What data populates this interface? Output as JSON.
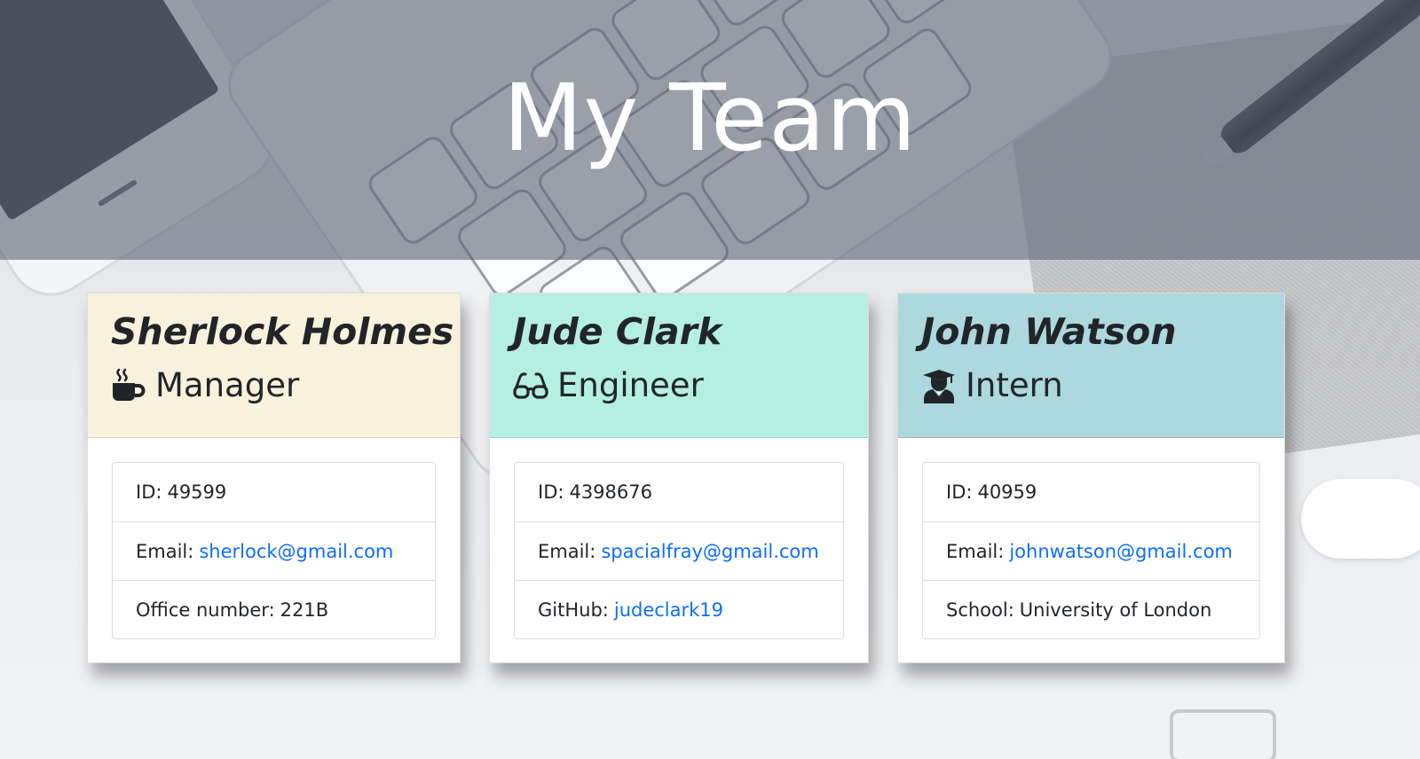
{
  "page": {
    "title": "My Team"
  },
  "colors": {
    "header_overlay": "#606576",
    "manager_header": "#f8f2dd",
    "engineer_header": "#b5efe3",
    "intern_header": "#acd8de",
    "link": "#0d6efd"
  },
  "team": [
    {
      "name": "Sherlock Holmes",
      "role": "Manager",
      "role_icon": "coffee-mug-icon",
      "items": [
        {
          "label": "ID:",
          "value": "49599"
        },
        {
          "label": "Email:",
          "value": "sherlock@gmail.com",
          "link": true
        },
        {
          "label": "Office number:",
          "value": "221B"
        }
      ]
    },
    {
      "name": "Jude Clark",
      "role": "Engineer",
      "role_icon": "glasses-icon",
      "items": [
        {
          "label": "ID:",
          "value": "4398676"
        },
        {
          "label": "Email:",
          "value": "spacialfray@gmail.com",
          "link": true
        },
        {
          "label": "GitHub:",
          "value": "judeclark19",
          "link": true
        }
      ]
    },
    {
      "name": "John Watson",
      "role": "Intern",
      "role_icon": "graduate-icon",
      "items": [
        {
          "label": "ID:",
          "value": "40959"
        },
        {
          "label": "Email:",
          "value": "johnwatson@gmail.com",
          "link": true
        },
        {
          "label": "School:",
          "value": "University of London"
        }
      ]
    }
  ]
}
